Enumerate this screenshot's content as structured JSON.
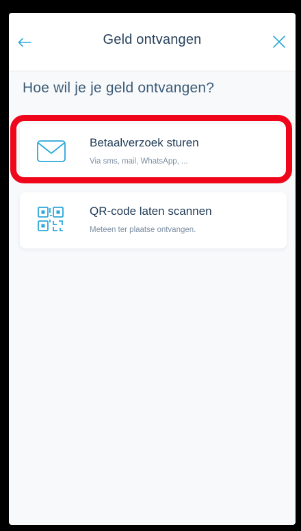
{
  "header": {
    "title": "Geld ontvangen",
    "back_icon": "arrow-left-icon",
    "close_icon": "close-icon"
  },
  "question": "Hoe wil je je geld ontvangen?",
  "options": [
    {
      "icon": "envelope-icon",
      "title": "Betaalverzoek sturen",
      "subtitle": "Via sms, mail, WhatsApp, ..."
    },
    {
      "icon": "qr-code-icon",
      "title": "QR-code laten scannen",
      "subtitle": "Meteen ter plaatse ontvangen."
    }
  ],
  "colors": {
    "accent": "#2aa8d8",
    "highlight": "#f0061b",
    "title_text": "#27415a"
  }
}
